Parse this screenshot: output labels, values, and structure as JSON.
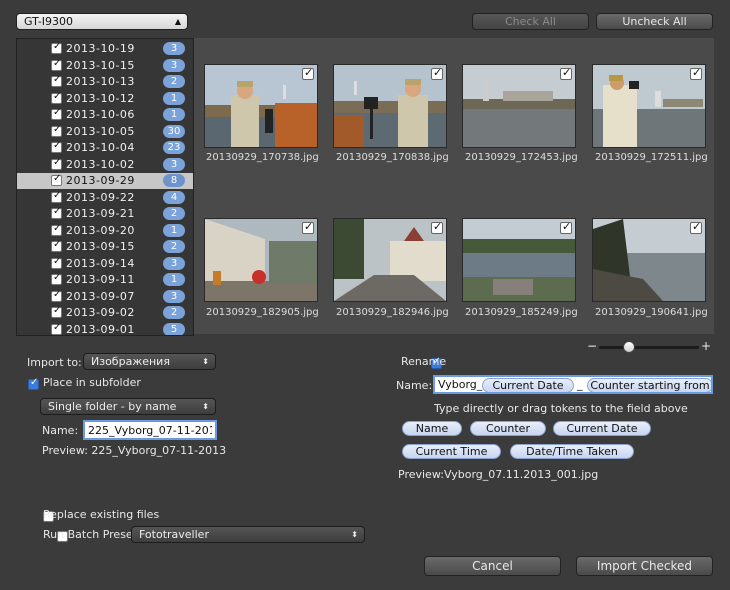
{
  "device_select": {
    "value": "GT-I9300"
  },
  "check_all": "Check All",
  "uncheck_all": "Uncheck All",
  "dates": [
    {
      "date": "2013-10-19",
      "count": "3",
      "checked": true
    },
    {
      "date": "2013-10-15",
      "count": "3",
      "checked": true
    },
    {
      "date": "2013-10-13",
      "count": "2",
      "checked": true
    },
    {
      "date": "2013-10-12",
      "count": "1",
      "checked": true
    },
    {
      "date": "2013-10-06",
      "count": "1",
      "checked": true
    },
    {
      "date": "2013-10-05",
      "count": "30",
      "checked": true
    },
    {
      "date": "2013-10-04",
      "count": "23",
      "checked": true
    },
    {
      "date": "2013-10-02",
      "count": "3",
      "checked": true
    },
    {
      "date": "2013-09-29",
      "count": "8",
      "checked": true,
      "selected": true
    },
    {
      "date": "2013-09-22",
      "count": "4",
      "checked": true
    },
    {
      "date": "2013-09-21",
      "count": "2",
      "checked": true
    },
    {
      "date": "2013-09-20",
      "count": "1",
      "checked": true
    },
    {
      "date": "2013-09-15",
      "count": "2",
      "checked": true
    },
    {
      "date": "2013-09-14",
      "count": "3",
      "checked": true
    },
    {
      "date": "2013-09-11",
      "count": "1",
      "checked": true
    },
    {
      "date": "2013-09-07",
      "count": "3",
      "checked": true
    },
    {
      "date": "2013-09-02",
      "count": "2",
      "checked": true
    },
    {
      "date": "2013-09-01",
      "count": "5",
      "checked": true
    }
  ],
  "photos": [
    {
      "file": "20130929_170738.jpg",
      "checked": true
    },
    {
      "file": "20130929_170838.jpg",
      "checked": true
    },
    {
      "file": "20130929_172453.jpg",
      "checked": true
    },
    {
      "file": "20130929_172511.jpg",
      "checked": true
    },
    {
      "file": "20130929_182905.jpg",
      "checked": true
    },
    {
      "file": "20130929_182946.jpg",
      "checked": true
    },
    {
      "file": "20130929_185249.jpg",
      "checked": true
    },
    {
      "file": "20130929_190641.jpg",
      "checked": true
    }
  ],
  "zoom": {
    "minus": "−",
    "plus": "+",
    "level": 0.3
  },
  "import_to": {
    "label": "Import to:",
    "value": "Изображения"
  },
  "subfolder": {
    "label": "Place in subfolder",
    "checked": true,
    "mode": "Single folder - by name",
    "name_label": "Name:",
    "name_value": "225_Vyborg_07-11-2013",
    "preview": "Preview: 225_Vyborg_07-11-2013"
  },
  "rename": {
    "label": "Rename",
    "checked": true,
    "name_label": "Name:",
    "field_text": "Vyborg_",
    "field_token1": "Current Date",
    "field_sep": "_",
    "field_token2": "Counter starting from",
    "hint": "Type directly or drag tokens to the field above",
    "tokens": [
      "Name",
      "Counter",
      "Current Date",
      "Current Time",
      "Date/Time Taken"
    ],
    "preview_label": "Preview:",
    "preview_value": "Vyborg_07.11.2013_001.jpg"
  },
  "replace_existing": {
    "label": "Replace existing files",
    "checked": false
  },
  "batch": {
    "label": "Run Batch Preset",
    "checked": false,
    "value": "Fototraveller"
  },
  "cancel": "Cancel",
  "import_checked": "Import Checked"
}
